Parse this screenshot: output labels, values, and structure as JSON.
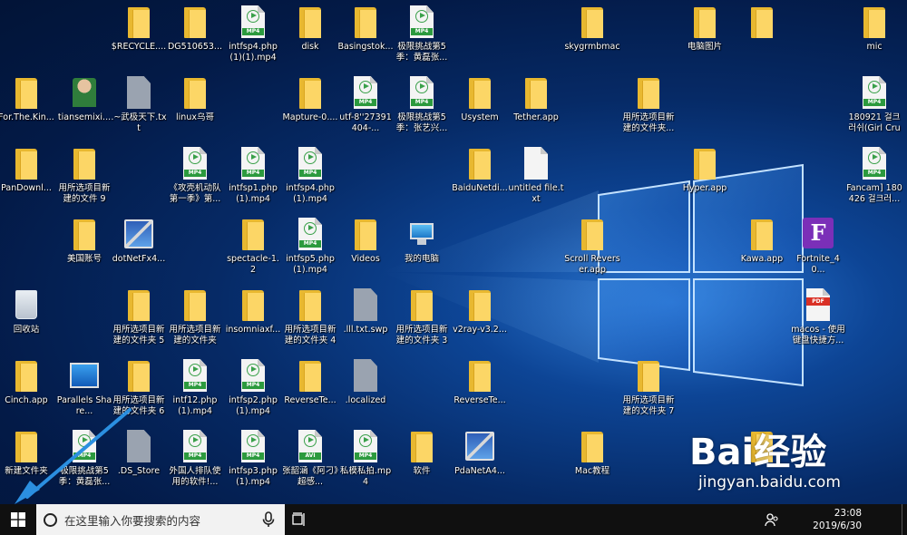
{
  "desktop": {
    "icons": [
      {
        "label": "$RECYCLE....",
        "type": "folder"
      },
      {
        "label": "DG510653...",
        "type": "folder"
      },
      {
        "label": "intfsp4.php (1)(1).mp4",
        "type": "mp4"
      },
      {
        "label": "disk",
        "type": "folder"
      },
      {
        "label": "Basingstok...",
        "type": "folder"
      },
      {
        "label": "极限挑战第5季：黄磊张...",
        "type": "mp4"
      },
      {
        "label": "skygrmbmac",
        "type": "folder"
      },
      {
        "label": "电脑图片",
        "type": "folder"
      },
      {
        "label": "",
        "type": "folder"
      },
      {
        "label": "mic",
        "type": "folder"
      },
      {
        "label": "For.The.Kin...",
        "type": "folder"
      },
      {
        "label": "tiansemixi...",
        "type": "avatar"
      },
      {
        "label": ".~武极天下.txt",
        "type": "file-grey"
      },
      {
        "label": "linux乌哥",
        "type": "folder"
      },
      {
        "label": "Mapture-0....",
        "type": "folder"
      },
      {
        "label": "utf-8''27391404-...",
        "type": "mp4"
      },
      {
        "label": "极限挑战第5季：张艺兴...",
        "type": "mp4"
      },
      {
        "label": "Usystem",
        "type": "folder"
      },
      {
        "label": "Tether.app",
        "type": "folder"
      },
      {
        "label": "用所选项目新建的文件夹...",
        "type": "folder"
      },
      {
        "label": "180921 걸크러쉬(Girl Crus...",
        "type": "mp4"
      },
      {
        "label": "PanDownl...",
        "type": "folder"
      },
      {
        "label": "用所选项目新建的文件 9",
        "type": "folder"
      },
      {
        "label": "《攻壳机动队第一季》第...",
        "type": "mp4"
      },
      {
        "label": "intfsp1.php (1).mp4",
        "type": "mp4"
      },
      {
        "label": "intfsp4.php (1).mp4",
        "type": "mp4"
      },
      {
        "label": "BaiduNetdi...",
        "type": "folder"
      },
      {
        "label": "untitled file.txt",
        "type": "file"
      },
      {
        "label": "Hyper.app",
        "type": "folder"
      },
      {
        "label": "Fancam] 180426 걸크러...",
        "type": "mp4"
      },
      {
        "label": "美国账号",
        "type": "folder"
      },
      {
        "label": "dotNetFx4...",
        "type": "installer"
      },
      {
        "label": "spectacle-1.2",
        "type": "folder"
      },
      {
        "label": "intfsp5.php (1).mp4",
        "type": "mp4"
      },
      {
        "label": "Videos",
        "type": "folder"
      },
      {
        "label": "我的电脑",
        "type": "pc"
      },
      {
        "label": "Scroll Reverser.app",
        "type": "folder"
      },
      {
        "label": "Kawa.app",
        "type": "folder"
      },
      {
        "label": "Fortnite_40...",
        "type": "fortnite"
      },
      {
        "label": "回收站",
        "type": "recycle"
      },
      {
        "label": "用所选项目新建的文件夹 5",
        "type": "folder"
      },
      {
        "label": "用所选项目新建的文件夹",
        "type": "folder"
      },
      {
        "label": "insomniaxf...",
        "type": "folder"
      },
      {
        "label": "用所选项目新建的文件夹 4",
        "type": "folder"
      },
      {
        "label": ".lll.txt.swp",
        "type": "file-grey"
      },
      {
        "label": "用所选项目新建的文件夹 3",
        "type": "folder"
      },
      {
        "label": "v2ray-v3.2...",
        "type": "folder"
      },
      {
        "label": "macos - 使用键盘快捷方...",
        "type": "pdf"
      },
      {
        "label": "Cinch.app",
        "type": "folder"
      },
      {
        "label": "Parallels Share...",
        "type": "parallels"
      },
      {
        "label": "用所选项目新建的文件夹 6",
        "type": "folder"
      },
      {
        "label": "intf12.php (1).mp4",
        "type": "mp4"
      },
      {
        "label": "intfsp2.php (1).mp4",
        "type": "mp4"
      },
      {
        "label": "ReverseTe...",
        "type": "folder"
      },
      {
        "label": ".localized",
        "type": "file-grey"
      },
      {
        "label": "ReverseTe...",
        "type": "folder"
      },
      {
        "label": "用所选项目新建的文件夹 7",
        "type": "folder"
      },
      {
        "label": "新建文件夹",
        "type": "folder"
      },
      {
        "label": "极限挑战第5季：黄磊张...",
        "type": "mp4"
      },
      {
        "label": ".DS_Store",
        "type": "file-grey"
      },
      {
        "label": "外国人排队使用的软件!...",
        "type": "mp4"
      },
      {
        "label": "intfsp3.php (1).mp4",
        "type": "mp4"
      },
      {
        "label": "张韶涵《阿刁》超感...",
        "type": "avi"
      },
      {
        "label": "私模私拍.mp4",
        "type": "mp4"
      },
      {
        "label": "软件",
        "type": "folder"
      },
      {
        "label": "PdaNetA4...",
        "type": "installer"
      },
      {
        "label": "Mac教程",
        "type": "folder"
      },
      {
        "label": "",
        "type": "folder"
      }
    ]
  },
  "taskbar": {
    "search_placeholder": "在这里输入你要搜索的内容",
    "clock_time": "23:08",
    "clock_date": "2019/6/30"
  },
  "watermark": {
    "brand": "Bai经验",
    "url": "jingyan.baidu.com"
  },
  "colors": {
    "accent_arrow": "#2b8fe0",
    "taskbar": "#101010",
    "folder": "#fcd666"
  }
}
